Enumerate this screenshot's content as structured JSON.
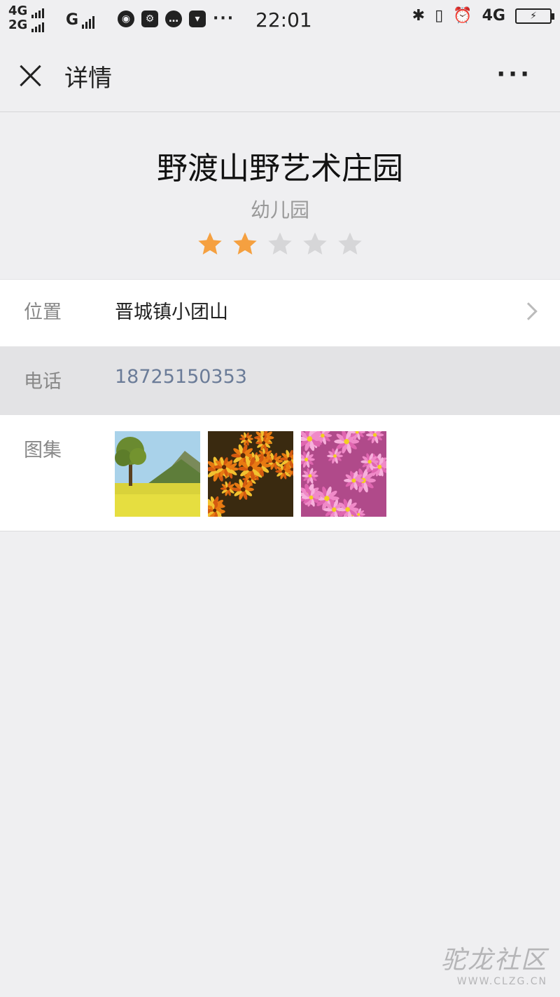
{
  "status_bar": {
    "net1": "4G",
    "net2": "2G",
    "net3": "G",
    "more": "···",
    "time": "22:01",
    "net_right": "4G",
    "icons": [
      "globe-icon",
      "settings-app-icon",
      "message-icon",
      "bag-icon",
      "bluetooth-icon",
      "vibrate-icon",
      "alarm-icon",
      "battery-charging-icon"
    ]
  },
  "nav": {
    "title": "详情",
    "more": "···"
  },
  "place": {
    "name": "野渡山野艺术庄园",
    "type": "幼儿园",
    "rating": 2,
    "rating_max": 5
  },
  "details": {
    "location_label": "位置",
    "location_value": "晋城镇小团山",
    "phone_label": "电话",
    "phone_value": "18725150353",
    "gallery_label": "图集",
    "gallery": [
      "landscape-photo",
      "orange-flowers-photo",
      "pink-flowers-photo"
    ]
  },
  "watermark": {
    "main": "驼龙社区",
    "sub": "WWW.CLZG.CN"
  },
  "colors": {
    "star_active": "#f5a040",
    "star_inactive": "#d6d6d8",
    "phone_text": "#6b7c98",
    "page_bg": "#efeff1"
  }
}
